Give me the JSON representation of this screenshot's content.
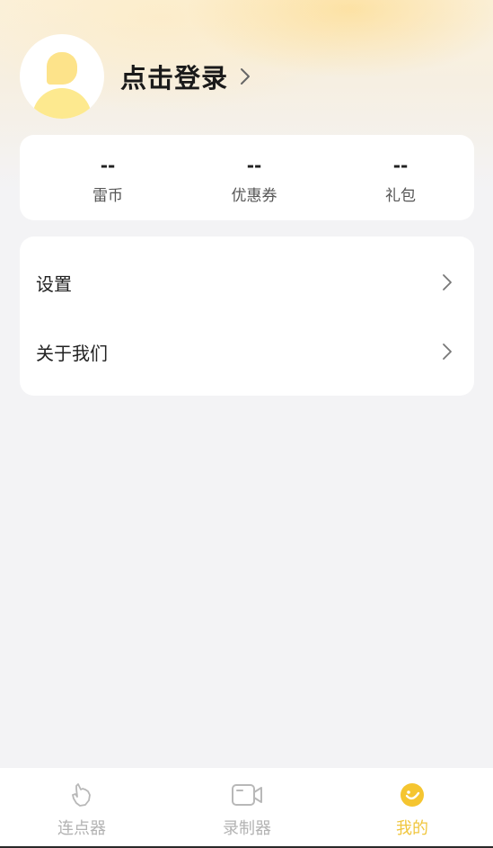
{
  "header": {
    "login_label": "点击登录",
    "icons": {
      "avatar": "user-avatar-icon",
      "arrow": "chevron-right-icon"
    }
  },
  "stats": [
    {
      "value": "--",
      "label": "雷币"
    },
    {
      "value": "--",
      "label": "优惠券"
    },
    {
      "value": "--",
      "label": "礼包"
    }
  ],
  "menu": [
    {
      "label": "设置",
      "icon": "chevron-right-icon"
    },
    {
      "label": "关于我们",
      "icon": "chevron-right-icon"
    }
  ],
  "tabbar": {
    "tabs": [
      {
        "label": "连点器",
        "icon": "tap-hand-icon",
        "active": false
      },
      {
        "label": "录制器",
        "icon": "video-camera-icon",
        "active": false
      },
      {
        "label": "我的",
        "icon": "smiley-face-icon",
        "active": true
      }
    ]
  },
  "colors": {
    "accent": "#f0c63e",
    "avatar_fill": "#fde38a",
    "background": "#f3f3f5",
    "card": "#ffffff",
    "inactive_tab": "#b3b3b3"
  }
}
